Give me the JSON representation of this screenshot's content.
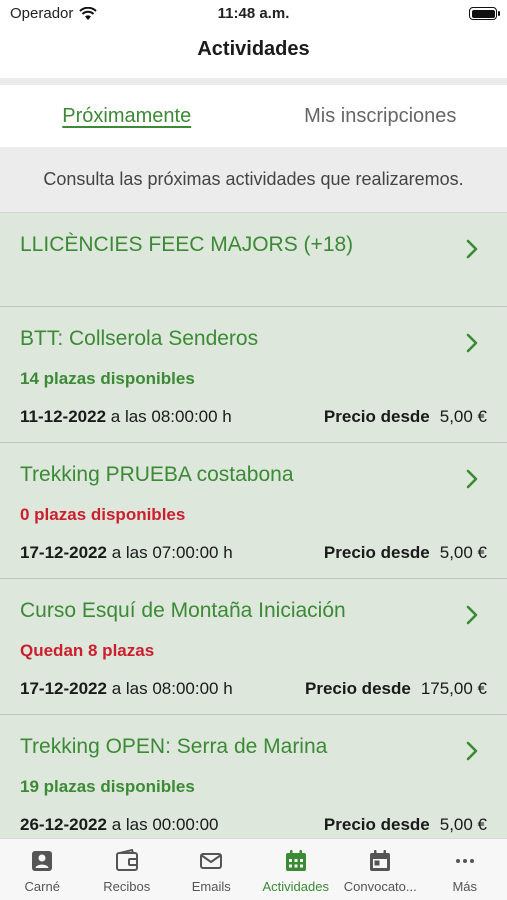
{
  "status": {
    "carrier": "Operador",
    "time": "11:48 a.m."
  },
  "nav": {
    "title": "Actividades"
  },
  "tabs": [
    {
      "label": "Próximamente",
      "active": true
    },
    {
      "label": "Mis inscripciones",
      "active": false
    }
  ],
  "info": "Consulta las próximas actividades que realizaremos.",
  "activities": [
    {
      "title": "LLICÈNCIES FEEC MAJORS (+18)"
    },
    {
      "title": "BTT: Collserola Senderos",
      "availability": "14 plazas disponibles",
      "availability_color": "#3c8a35",
      "date": "11-12-2022",
      "time_text": "a las 08:00:00 h",
      "price_label": "Precio desde",
      "price": "5,00 €"
    },
    {
      "title": "Trekking PRUEBA costabona",
      "availability": "0 plazas disponibles",
      "availability_color": "#cc1f2e",
      "date": "17-12-2022",
      "time_text": "a las 07:00:00 h",
      "price_label": "Precio desde",
      "price": "5,00 €"
    },
    {
      "title": "Curso Esquí de Montaña Iniciación",
      "availability": "Quedan 8 plazas",
      "availability_color": "#cc1f2e",
      "date": "17-12-2022",
      "time_text": "a las 08:00:00 h",
      "price_label": "Precio desde",
      "price": "175,00 €"
    },
    {
      "title": "Trekking OPEN: Serra de Marina",
      "availability": "19 plazas disponibles",
      "availability_color": "#3c8a35",
      "date": "26-12-2022",
      "time_text": "a las 00:00:00",
      "price_label": "Precio desde",
      "price": "5,00 €"
    }
  ],
  "tabbar": [
    {
      "label": "Carné",
      "icon": "id-card-icon",
      "active": false
    },
    {
      "label": "Recibos",
      "icon": "wallet-icon",
      "active": false
    },
    {
      "label": "Emails",
      "icon": "mail-icon",
      "active": false
    },
    {
      "label": "Actividades",
      "icon": "calendar-grid-icon",
      "active": true
    },
    {
      "label": "Convocato...",
      "icon": "calendar-icon",
      "active": false
    },
    {
      "label": "Más",
      "icon": "more-icon",
      "active": false
    }
  ],
  "colors": {
    "accent": "#3c8a35",
    "alert": "#cc1f2e",
    "card_bg": "#dde7dc"
  }
}
